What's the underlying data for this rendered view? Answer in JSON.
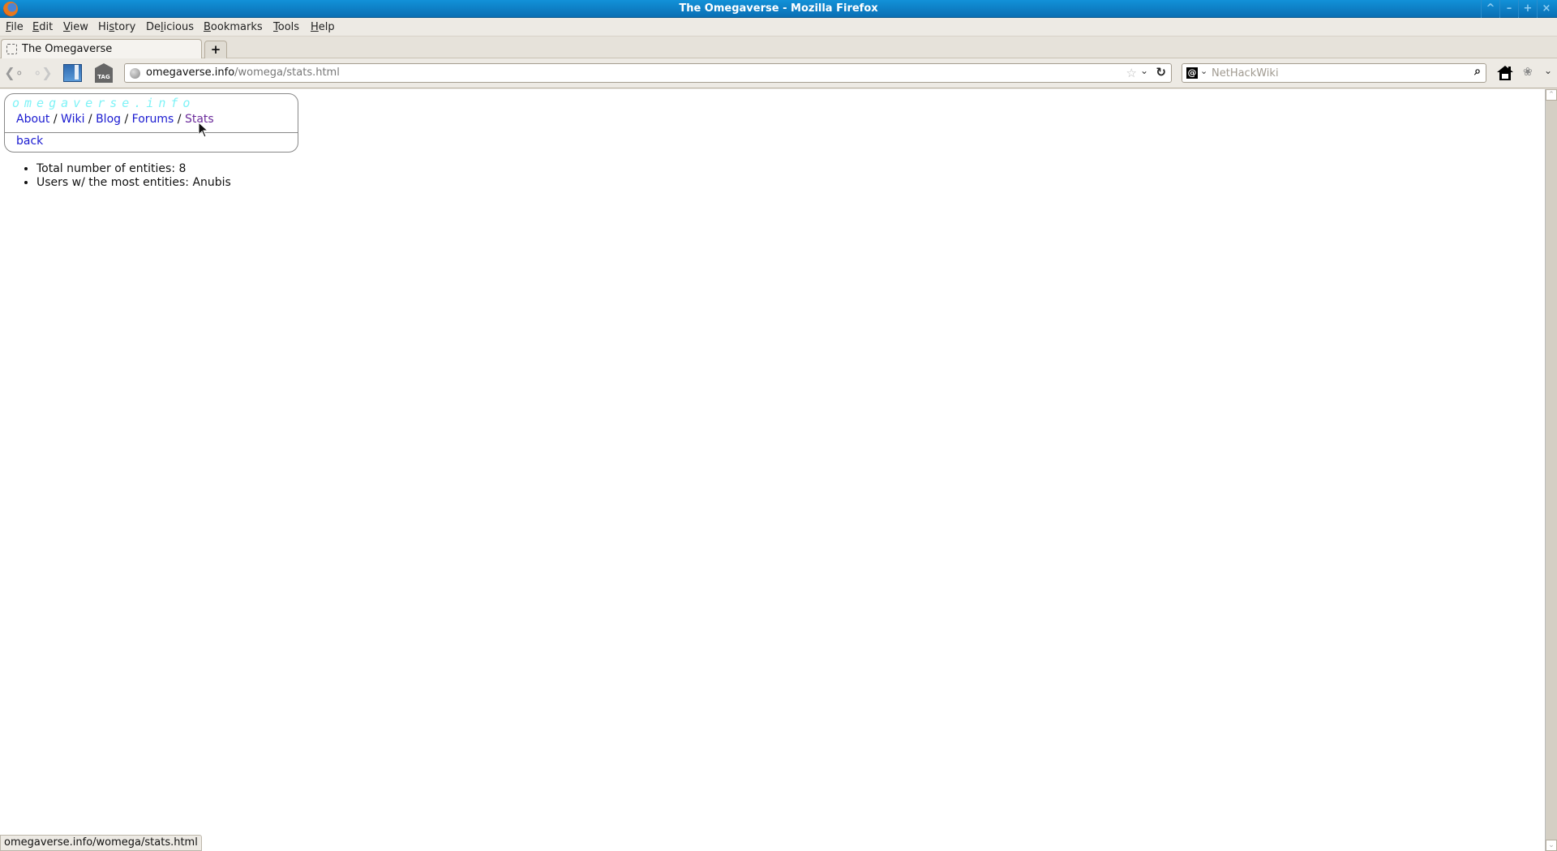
{
  "window": {
    "title": "The Omegaverse - Mozilla Firefox",
    "controls": [
      "^",
      "–",
      "+",
      "×"
    ]
  },
  "menubar": {
    "items": [
      {
        "label": "File",
        "accel": "F"
      },
      {
        "label": "Edit",
        "accel": "E"
      },
      {
        "label": "View",
        "accel": "V"
      },
      {
        "label": "History",
        "accel": "s"
      },
      {
        "label": "Delicious",
        "accel": "l"
      },
      {
        "label": "Bookmarks",
        "accel": "B"
      },
      {
        "label": "Tools",
        "accel": "T"
      },
      {
        "label": "Help",
        "accel": "H"
      }
    ]
  },
  "tabs": {
    "items": [
      {
        "label": "The Omegaverse",
        "active": true
      }
    ],
    "new_tab_label": "+"
  },
  "navbar": {
    "back_icon": "back-arrow-icon",
    "forward_icon": "forward-arrow-icon",
    "url_domain": "omegaverse.info",
    "url_path": "/womega/stats.html",
    "search_placeholder": "NetHackWiki",
    "search_value": "",
    "search_engine_glyph": "@"
  },
  "page": {
    "logo": "omegaverse.info",
    "nav_links": [
      {
        "label": "About",
        "visited": false
      },
      {
        "label": "Wiki",
        "visited": false
      },
      {
        "label": "Blog",
        "visited": false
      },
      {
        "label": "Forums",
        "visited": false
      },
      {
        "label": "Stats",
        "visited": true
      }
    ],
    "separator": " / ",
    "back_label": "back",
    "stats": [
      "Total number of entities: 8",
      "Users w/ the most entities: Anubis"
    ]
  },
  "statusbar": {
    "text": "omegaverse.info/womega/stats.html"
  },
  "colors": {
    "titlebar": "#0a7dc6",
    "link": "#1a1ad0",
    "visited_link": "#6a2a9a",
    "logo": "#7ff3f7"
  }
}
